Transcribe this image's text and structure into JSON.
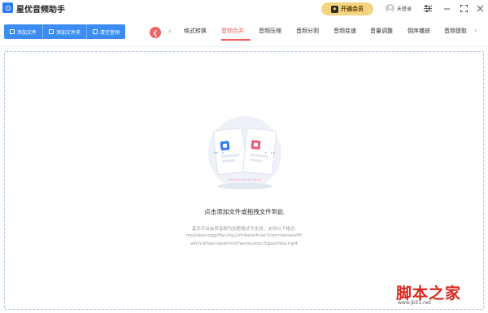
{
  "app": {
    "title": "星优音频助手",
    "vip_label": "开通会员",
    "user_label": "未登录"
  },
  "toolbar": {
    "add_file": "添加文件",
    "add_folder": "添加文件夹",
    "clear_list": "清空音频"
  },
  "tabs": [
    {
      "label": "格式转换",
      "active": false
    },
    {
      "label": "音频合并",
      "active": true
    },
    {
      "label": "音频压缩",
      "active": false
    },
    {
      "label": "音频分割",
      "active": false
    },
    {
      "label": "音频变速",
      "active": false
    },
    {
      "label": "音量调整",
      "active": false
    },
    {
      "label": "倒序播放",
      "active": false
    },
    {
      "label": "音频提取",
      "active": false
    }
  ],
  "dropzone": {
    "title": "点击添加文件或拖拽文件到此",
    "hint_lines": [
      "音乐平台会员音频为加密格式不支持，支持以下格式:",
      "mp3/wav/ogg/flac/mp2/m4a/m4r/ac3/amr/wma/aiff/",
      "aifc/caf/aac/ape/mmf/wv/au/voc/3gpp/mka/mp4"
    ]
  },
  "watermark": {
    "text": "脚本之家",
    "url": "www.jb51.net"
  },
  "colors": {
    "accent_blue": "#3b8cf5",
    "active_tab_red": "#f15b5b",
    "vip_gold": "#f5d47f",
    "watermark_red": "#d9261c"
  }
}
